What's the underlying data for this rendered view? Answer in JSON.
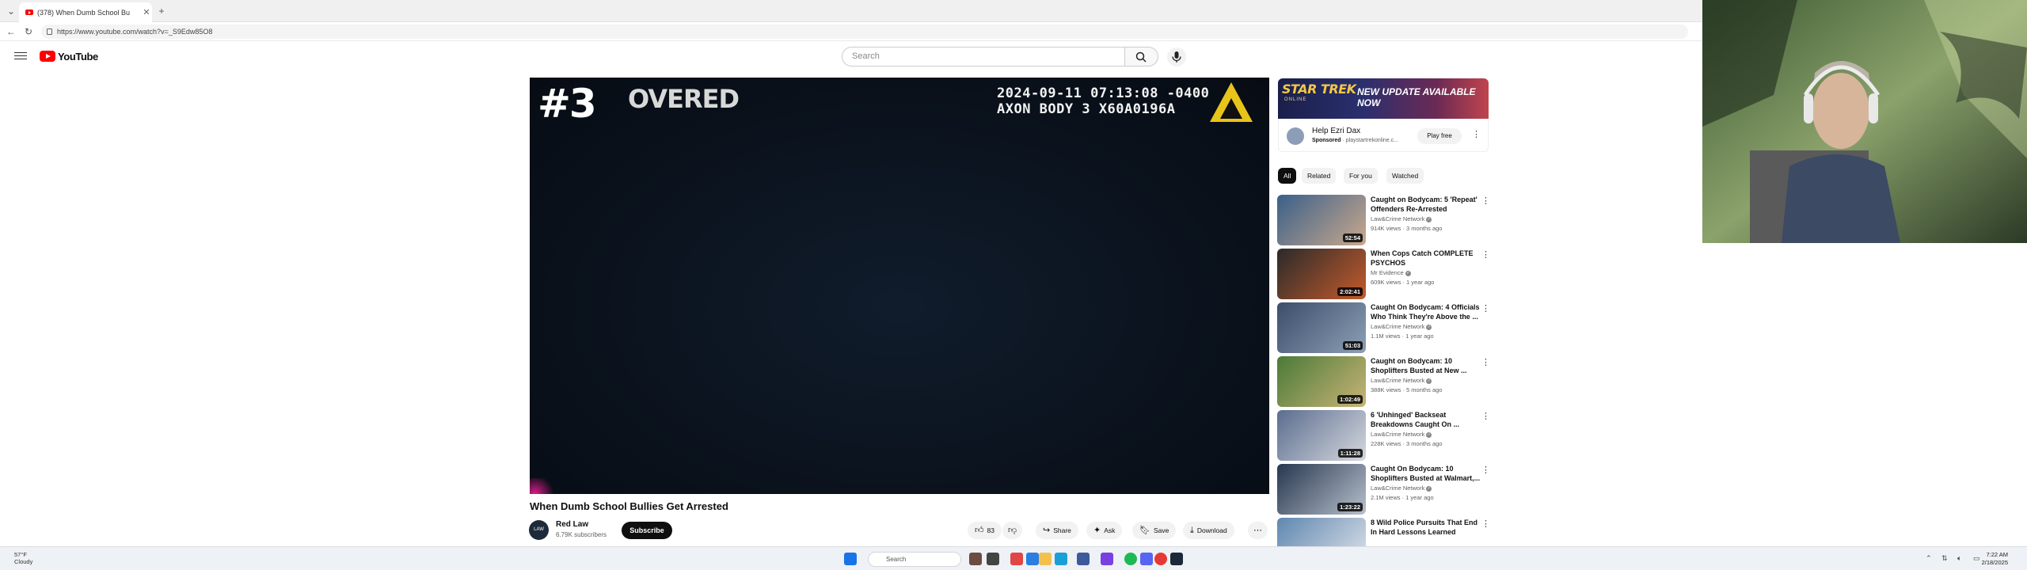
{
  "browser": {
    "tab_title": "(378) When Dumb School Bu",
    "url": "https://www.youtube.com/watch?v=_S9Edw85O8"
  },
  "header": {
    "logo_text": "YouTube",
    "search_placeholder": "Search"
  },
  "video": {
    "overlay_rank": "#3",
    "overlay_text": "OVERED",
    "timestamp_line1": "2024-09-11 07:13:08 -0400",
    "timestamp_line2": "AXON BODY 3 X60A0196A",
    "title": "When Dumb School Bullies Get Arrested",
    "channel": "Red Law",
    "subscribers": "6.79K subscribers",
    "subscribe_label": "Subscribe",
    "likes": "83",
    "share_label": "Share",
    "ask_label": "Ask",
    "save_label": "Save",
    "download_label": "Download"
  },
  "ad": {
    "brand_logo": "STAR TREK",
    "brand_sub": "ONLINE",
    "headline": "NEW UPDATE AVAILABLE NOW",
    "title": "Help Ezri Dax",
    "sponsored": "Sponsored",
    "sponsor_url": "playstartrekonline.c...",
    "cta": "Play free"
  },
  "chips": [
    "All",
    "Related",
    "For you",
    "Watched"
  ],
  "recommendations": [
    {
      "title": "Caught on Bodycam: 5 'Repeat' Offenders Re-Arrested",
      "channel": "Law&Crime Network",
      "meta": "914K views · 3 months ago",
      "duration": "52:54",
      "colors": [
        "#3a5f8a",
        "#c9a98c"
      ]
    },
    {
      "title": "When Cops Catch COMPLETE PSYCHOS",
      "channel": "Mr Evidence",
      "meta": "609K views · 1 year ago",
      "duration": "2:02:41",
      "colors": [
        "#2a2a2a",
        "#c45b2c"
      ]
    },
    {
      "title": "Caught On Bodycam: 4 Officials Who Think They're Above the ...",
      "channel": "Law&Crime Network",
      "meta": "1.1M views · 1 year ago",
      "duration": "51:03",
      "colors": [
        "#3b4d6a",
        "#8da0b6"
      ]
    },
    {
      "title": "Caught on Bodycam: 10 Shoplifters Busted at New ...",
      "channel": "Law&Crime Network",
      "meta": "388K views · 5 months ago",
      "duration": "1:02:49",
      "colors": [
        "#4b7a38",
        "#c8b476"
      ]
    },
    {
      "title": "6 'Unhinged' Backseat Breakdowns Caught On ...",
      "channel": "Law&Crime Network",
      "meta": "228K views · 3 months ago",
      "duration": "1:11:28",
      "colors": [
        "#5a6d8e",
        "#d6d8de"
      ]
    },
    {
      "title": "Caught On Bodycam: 10 Shoplifters Busted at Walmart,...",
      "channel": "Law&Crime Network",
      "meta": "2.1M views · 1 year ago",
      "duration": "1:23:22",
      "colors": [
        "#27374e",
        "#b7c0cc"
      ]
    },
    {
      "title": "8 Wild Police Pursuits That End In Hard Lessons Learned",
      "channel": "",
      "meta": "",
      "duration": "",
      "colors": [
        "#5f87b0",
        "#e0e4ea"
      ]
    }
  ],
  "taskbar": {
    "weather_temp": "57°F",
    "weather_desc": "Cloudy",
    "search_placeholder": "Search",
    "time": "7:22 AM",
    "date": "2/18/2025"
  }
}
